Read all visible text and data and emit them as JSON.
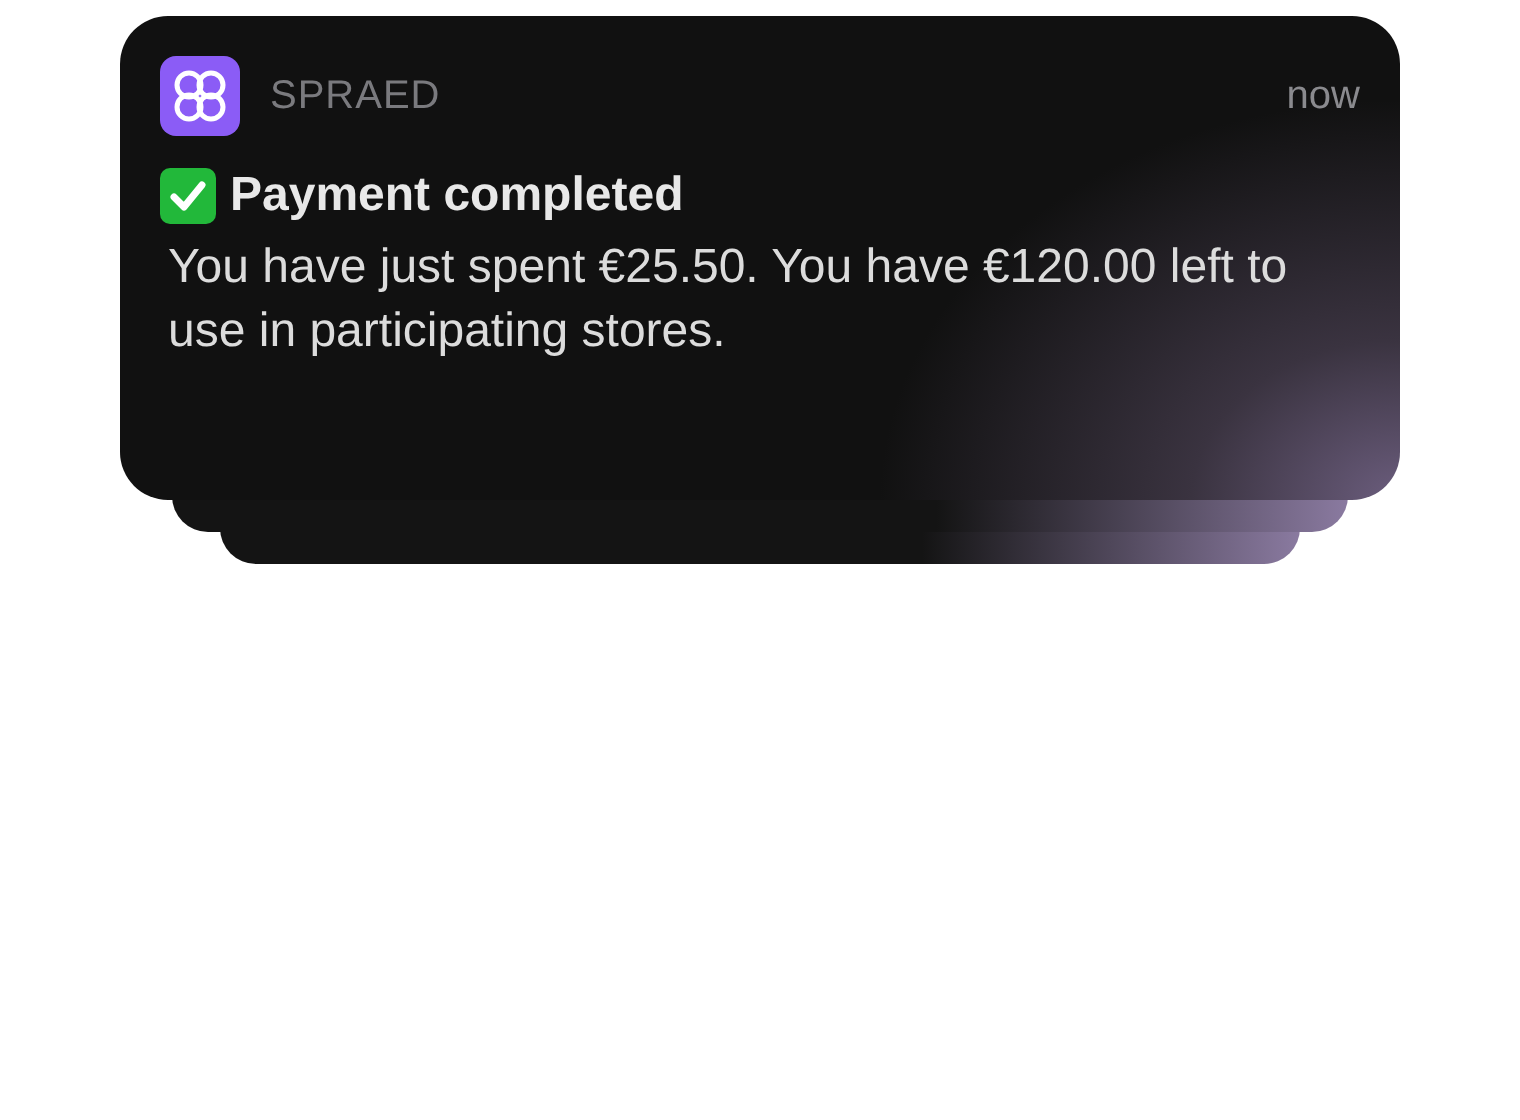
{
  "notification": {
    "app_name": "SPRAED",
    "time": "now",
    "title": "Payment completed",
    "body": "You have just spent €25.50. You have €120.00 left to use in participating stores."
  },
  "stacked_notifications": [
    {
      "kind": "stacked"
    },
    {
      "kind": "stacked"
    }
  ]
}
